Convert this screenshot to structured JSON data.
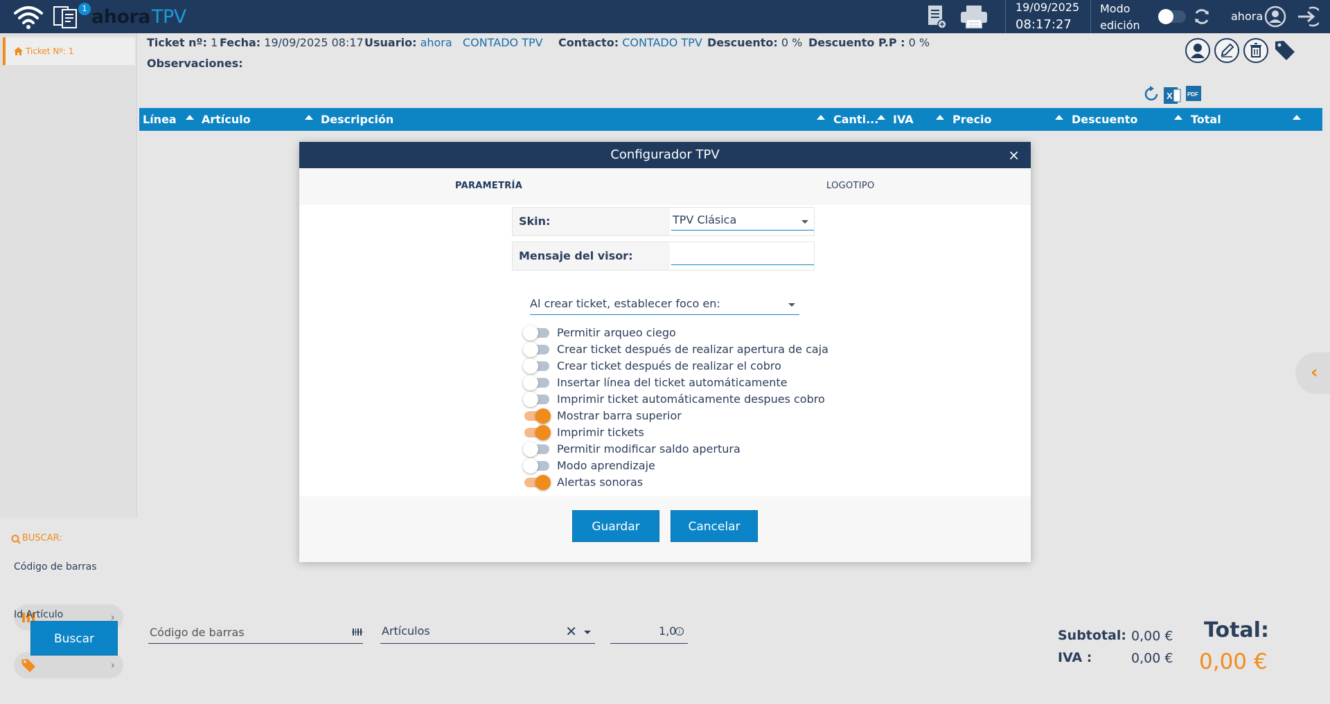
{
  "topbar": {
    "badge_count": "1",
    "logo_main": "ahora",
    "logo_sub": "TPV",
    "date": "19/09/2025",
    "time": "08:17:27",
    "modo_line1": "Modo",
    "modo_line2": "edición",
    "user": "ahora",
    "icons": [
      "wifi-icon",
      "tickets-icon",
      "new-document-icon",
      "printer-icon",
      "sync-icon",
      "user-circle-icon",
      "logout-icon"
    ]
  },
  "sidebar": {
    "tab_label": "Ticket Nº: 1",
    "search_title": "BUSCAR:",
    "barcode_label": "Código de barras",
    "article_label": "Id Artículo",
    "search_button": "Buscar"
  },
  "ticket": {
    "ticket_label": "Ticket nº:",
    "ticket_value": "1",
    "fecha_label": "Fecha:",
    "fecha_value": "19/09/2025 08:17",
    "usuario_label": "Usuario:",
    "usuario_value": "ahora",
    "cliente_value": "CONTADO TPV",
    "contacto_label": "Contacto:",
    "contacto_value": "CONTADO TPV",
    "descuento_label": "Descuento:",
    "descuento_value": "0 %",
    "descuento_pp_label": "Descuento P.P :",
    "descuento_pp_value": "0 %",
    "observaciones_label": "Observaciones:"
  },
  "grid": {
    "columns": [
      "Línea",
      "Artículo",
      "Descripción",
      "Canti...",
      "IVA",
      "Precio",
      "Descuento",
      "Total"
    ]
  },
  "bottom": {
    "barcode_placeholder": "Código de barras",
    "articulos_placeholder": "Artículos",
    "quantity": "1,0",
    "subtotal_label": "Subtotal:",
    "subtotal_value": "0,00 €",
    "iva_label": "IVA :",
    "iva_value": "0,00 €",
    "total_label": "Total:",
    "total_value": "0,00 €"
  },
  "dialog": {
    "title": "Configurador TPV",
    "close": "×",
    "tabs": [
      "PARAMETRÍA",
      "LOGOTIPO"
    ],
    "active_tab": "PARAMETRÍA",
    "skin_label": "Skin:",
    "skin_value": "TPV Clásica",
    "mensaje_label": "Mensaje del visor:",
    "mensaje_value": "",
    "focus_select": "Al crear ticket, establecer foco en:",
    "toggles": [
      {
        "label": "Permitir arqueo ciego",
        "on": false
      },
      {
        "label": "Crear ticket después de realizar apertura de caja",
        "on": false
      },
      {
        "label": "Crear ticket después de realizar el cobro",
        "on": false
      },
      {
        "label": "Insertar línea del ticket automáticamente",
        "on": false
      },
      {
        "label": "Imprimir ticket automáticamente despues cobro",
        "on": false
      },
      {
        "label": "Mostrar barra superior",
        "on": true
      },
      {
        "label": "Imprimir tickets",
        "on": true
      },
      {
        "label": "Permitir modificar saldo apertura",
        "on": false
      },
      {
        "label": "Modo aprendizaje",
        "on": false
      },
      {
        "label": "Alertas sonoras",
        "on": true
      }
    ],
    "save_button": "Guardar",
    "cancel_button": "Cancelar"
  },
  "colors": {
    "navy": "#203a5d",
    "blue": "#0d85c5",
    "orange": "#f08c1b"
  }
}
